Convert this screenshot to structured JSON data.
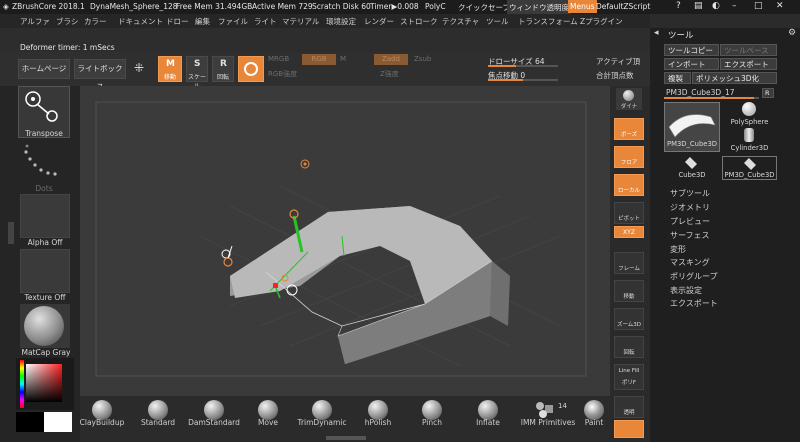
{
  "titlebar": {
    "app": "ZBrushCore 2018.1",
    "doc": "DynaMesh_Sphere_128",
    "free_mem": "Free Mem 31.494GB",
    "active_mem": "Active Mem 729",
    "scratch": "Scratch Disk 60",
    "timer": "Timer▶0.008",
    "poly": "PolyC",
    "quicksave": "クイックセーブ",
    "window_transparency": "ウィンドウ透明度",
    "menus": "Menus",
    "script": "DefaultZScript"
  },
  "menubar": [
    "アルファ",
    "ブラシ",
    "カラー",
    "ドキュメント",
    "ドロー",
    "編集",
    "ファイル",
    "ライト",
    "マテリアル",
    "環境設定",
    "レンダー",
    "ストローク",
    "テクスチャ",
    "ツール",
    "トランスフォーム",
    "Zプラグイン"
  ],
  "info": {
    "deformer_timer": "Deformer timer: 1 mSecs"
  },
  "toolbar": {
    "home": "ホームページ",
    "lightbox": "ライトボックス",
    "move_label": "移動",
    "scale_label": "スケール",
    "rotate_label": "回転",
    "mrgb": "MRGB",
    "rgb": "RGB",
    "m": "M",
    "zadd": "Zadd",
    "zsub": "Zsub",
    "rgb_intensity": "RGB強度",
    "z_intensity": "Z強度",
    "draw_size_label": "ドローサイズ",
    "draw_size_value": "64",
    "focal_shift_label": "焦点移動",
    "focal_shift_value": "0",
    "active_points": "アクティブ頂",
    "total_points": "合計頂点数"
  },
  "toolpanel": {
    "title": "ツール",
    "copy_tool": "ツールコピー",
    "paste_tool": "ツールペースト",
    "import": "インポート",
    "export": "エクスポート",
    "clone": "複製",
    "polymesh": "ポリメッシュ3D化",
    "current_tool": "PM3D_Cube3D_17",
    "r_label": "R",
    "tools": [
      "PM3D_Cube3D",
      "PolySphere",
      "Cylinder3D",
      "Cube3D",
      "PM3D_Cube3D"
    ],
    "menu": [
      "サブツール",
      "ジオメトリ",
      "プレビュー",
      "サーフェス",
      "変形",
      "マスキング",
      "ポリグループ",
      "表示設定",
      "エクスポート"
    ]
  },
  "leftshelf": {
    "transpose": "Transpose",
    "dots": "Dots",
    "alpha": "Alpha Off",
    "texture": "Texture Off",
    "matcap": "MatCap Gray"
  },
  "rightshelf": [
    "ポーズ",
    "フロア",
    "ローカル",
    "ピボット",
    "XYZ",
    "フレーム",
    "移動",
    "ズーム3D",
    "回転",
    "ポリF",
    "透明"
  ],
  "rightshelf_top": "ダイナ",
  "linefill": "Line Fill",
  "brushes": [
    "ClayBuildup",
    "Standard",
    "DamStandard",
    "Move",
    "TrimDynamic",
    "hPolish",
    "Pinch",
    "Inflate",
    "IMM Primitives",
    "Paint"
  ],
  "imm_count": "14",
  "accent": "#e8863a"
}
